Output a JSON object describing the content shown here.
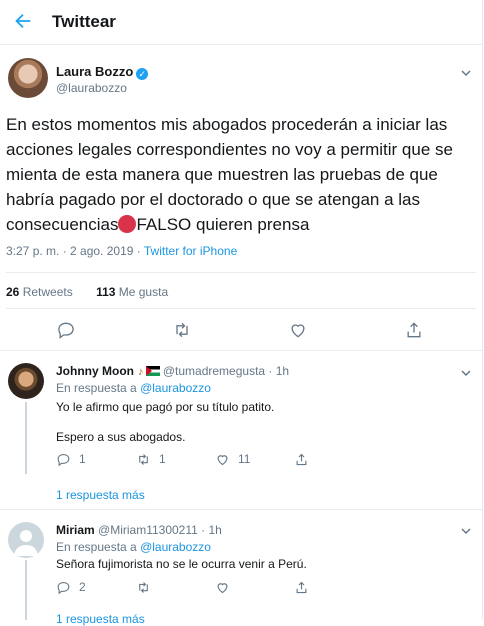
{
  "header": {
    "title": "Twittear"
  },
  "tweet": {
    "author_name": "Laura Bozzo",
    "author_handle": "@laurabozzo",
    "text_main": "En estos momentos mis abogados procederán a iniciar las acciones legales correspondientes no voy a permitir que se mienta de esta manera que muestren las pruebas de que habría pagado por el doctorado o que se atengan a las consecuencias",
    "text_tail": "FALSO quieren prensa",
    "time": "3:27 p. m. · 2 ago. 2019 · ",
    "source": "Twitter for iPhone",
    "retweets_count": "26",
    "retweets_label": " Retweets",
    "likes_count": "113",
    "likes_label": " Me gusta"
  },
  "replies": [
    {
      "name": "Johnny Moon",
      "handle": "@tumadremegusta · 1h",
      "in_reply_prefix": "En respuesta a ",
      "mention": "@laurabozzo",
      "line1": "Yo le afirmo que pagó por su título patito.",
      "line2": "Espero a sus abogados.",
      "reply_count": "1",
      "retweet_count": "1",
      "like_count": "11",
      "more": "1 respuesta más"
    },
    {
      "name": "Miriam",
      "handle": "@Miriam11300211 · 1h",
      "in_reply_prefix": "En respuesta a ",
      "mention": "@laurabozzo",
      "line1": "Señora fujimorista no se le ocurra venir a Perú.",
      "reply_count": "2",
      "retweet_count": "",
      "like_count": "",
      "more": "1 respuesta más"
    }
  ],
  "colors": {
    "accent": "#1da1f2",
    "muted": "#657786",
    "border": "#e6ecf0"
  }
}
